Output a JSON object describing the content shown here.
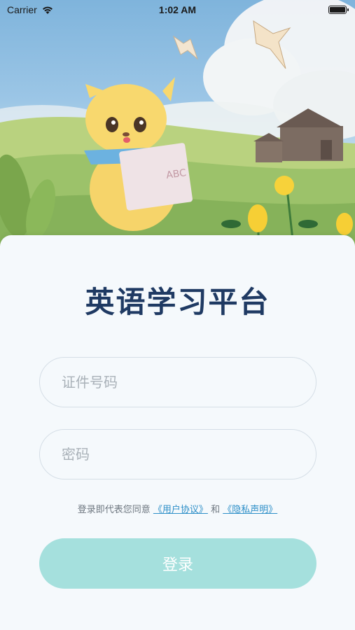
{
  "status_bar": {
    "carrier": "Carrier",
    "time": "1:02 AM",
    "battery_level": 1.0
  },
  "app": {
    "title": "英语学习平台"
  },
  "form": {
    "id_placeholder": "证件号码",
    "password_placeholder": "密码",
    "id_value": "",
    "password_value": ""
  },
  "agreement": {
    "prefix": "登录即代表您同意",
    "user_agreement": "《用户协议》",
    "conjunction": "和",
    "privacy_policy": "《隐私声明》"
  },
  "login_button": {
    "label": "登录"
  },
  "colors": {
    "title": "#1f3a63",
    "link": "#2d8fc8",
    "button_bg": "#a5e0dd",
    "card_bg": "#f5f9fc"
  },
  "icons": {
    "wifi": "wifi-icon",
    "battery": "battery-icon"
  }
}
